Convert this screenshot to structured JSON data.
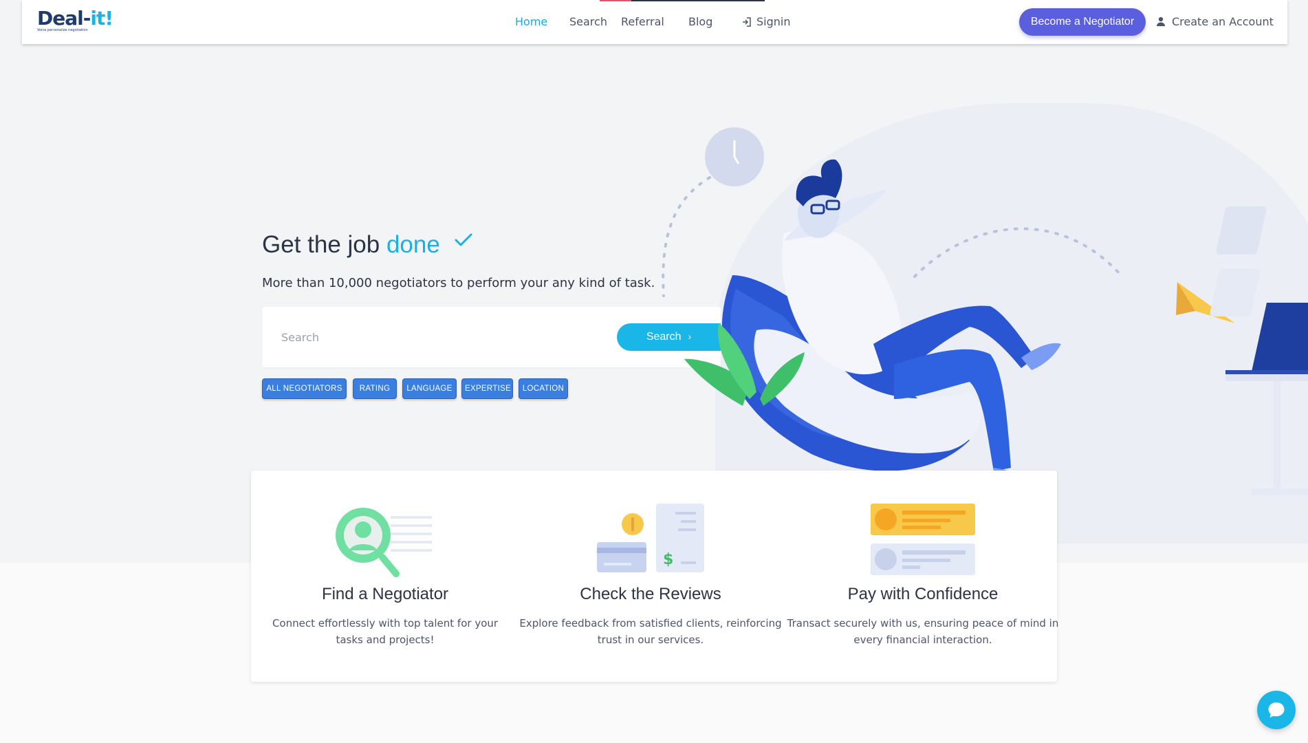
{
  "navbar": {
    "logo_text": "Deal-",
    "logo_accent": "it!",
    "logo_tagline": "Voice personalize negotiation",
    "links": [
      {
        "label": "Home",
        "active": true
      },
      {
        "label": "Search"
      },
      {
        "label": "Referral"
      },
      {
        "label": "Blog"
      },
      {
        "label": "Signin",
        "icon": "signin-icon"
      }
    ],
    "become_negotiator": "Become a Negotiator",
    "create_account": "Create an Account"
  },
  "hero": {
    "title_prefix": "Get the job ",
    "title_accent": "done",
    "subtitle": "More than 10,000 negotiators to perform your any kind of task.",
    "search_placeholder": "Search",
    "search_value": "",
    "search_button": "Search",
    "filters": [
      "ALL NEGOTIATORS",
      "RATING",
      "LANGUAGE",
      "EXPERTISE",
      "LOCATION"
    ]
  },
  "features": [
    {
      "title": "Find a Negotiator",
      "text_line1": "Connect effortlessly with top talent for your",
      "text_line2": "tasks and projects!"
    },
    {
      "title": "Check the Reviews",
      "text_line1": "Explore feedback from satisfied clients, reinforcing",
      "text_line2": "trust in our services."
    },
    {
      "title": "Pay with Confidence",
      "text_line1": "Transact securely with us, ensuring peace of mind in",
      "text_line2": "every financial interaction."
    }
  ],
  "colors": {
    "accent": "#1ab6e8",
    "primary_button": "#5b5fdd",
    "chip": "#3a7fe0",
    "text": "#2b3445"
  }
}
